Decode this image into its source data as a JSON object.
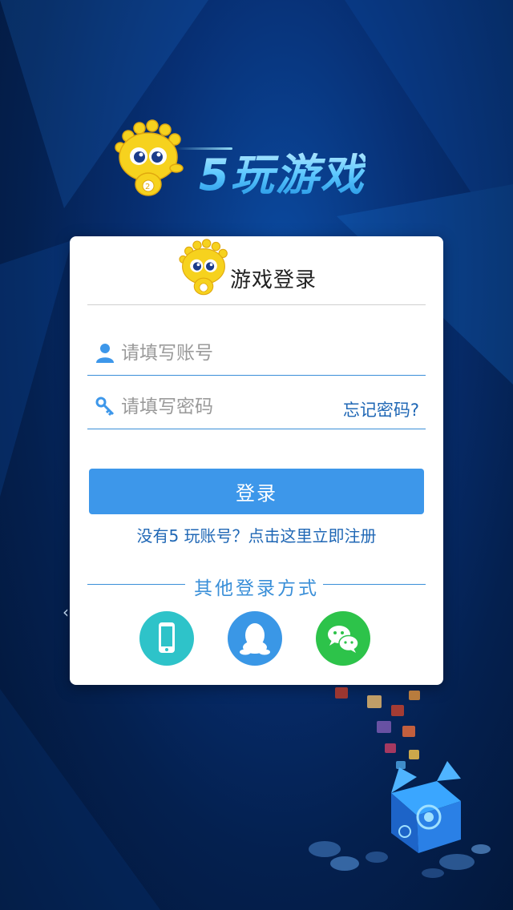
{
  "header": {
    "logo_text": "5玩游戏"
  },
  "card": {
    "title": "游戏登录",
    "username": {
      "placeholder": "请填写账号",
      "value": ""
    },
    "password": {
      "placeholder": "请填写密码",
      "value": ""
    },
    "forgot_label": "忘记密码?",
    "login_label": "登录",
    "register_label": "没有5 玩账号？点击这里立即注册",
    "other_login_title": "其他登录方式",
    "social": [
      {
        "icon": "phone-icon"
      },
      {
        "icon": "qq-icon"
      },
      {
        "icon": "wechat-icon"
      }
    ]
  },
  "colors": {
    "accent": "#3d97ea",
    "link": "#1f67b5",
    "phone": "#2ec3c9",
    "qq": "#3a97e6",
    "wechat": "#2dc34a"
  },
  "decor": {
    "side_arrow": "‹"
  }
}
